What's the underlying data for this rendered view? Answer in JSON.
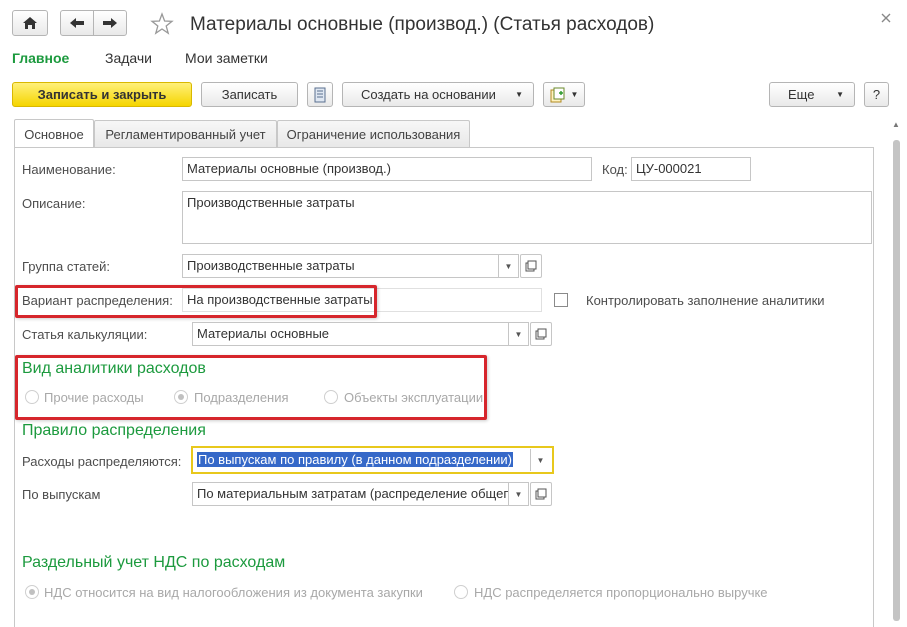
{
  "window": {
    "title": "Материалы основные (производ.) (Статья расходов)"
  },
  "nav": {
    "main": "Главное",
    "tasks": "Задачи",
    "notes": "Мои заметки"
  },
  "toolbar": {
    "save_close": "Записать и закрыть",
    "save": "Записать",
    "create_based": "Создать на основании",
    "more": "Еще",
    "help": "?"
  },
  "tabs": [
    {
      "label": "Основное"
    },
    {
      "label": "Регламентированный учет"
    },
    {
      "label": "Ограничение использования"
    }
  ],
  "form": {
    "name_label": "Наименование:",
    "name_value": "Материалы основные (производ.)",
    "code_label": "Код:",
    "code_value": "ЦУ-000021",
    "desc_label": "Описание:",
    "desc_value": "Производственные затраты",
    "group_label": "Группа статей:",
    "group_value": "Производственные затраты",
    "variant_label": "Вариант распределения:",
    "variant_value": "На производственные затраты",
    "control_label": "Контролировать заполнение аналитики",
    "calc_label": "Статья калькуляции:",
    "calc_value": "Материалы основные"
  },
  "analytics": {
    "title": "Вид аналитики расходов",
    "options": [
      "Прочие расходы",
      "Подразделения",
      "Объекты эксплуатации"
    ],
    "selected": "Подразделения"
  },
  "rule": {
    "title": "Правило распределения",
    "distributed_label": "Расходы распределяются:",
    "distributed_value": "По выпускам по правилу (в данном подразделении)",
    "by_output_label": "По выпускам",
    "by_output_value": "По материальным затратам (распределение общеп"
  },
  "vat": {
    "title": "Раздельный учет НДС по расходам",
    "options": [
      "НДС относится на вид налогообложения из документа закупки",
      "НДС распределяется пропорционально выручке"
    ]
  },
  "colors": {
    "accent_green": "#1c9a3e",
    "primary_yellow": "#f5d500",
    "highlight_red": "#d6262c",
    "selection_blue": "#3568c8"
  }
}
